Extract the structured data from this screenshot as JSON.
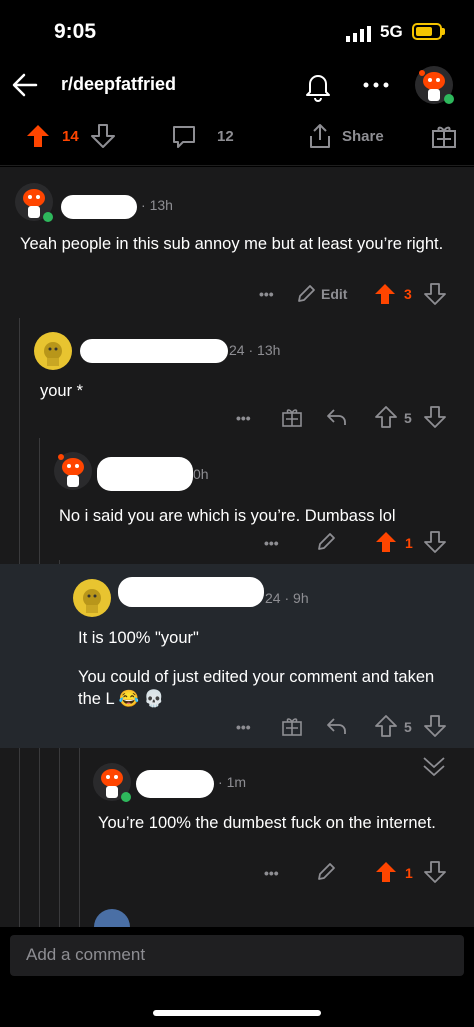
{
  "status": {
    "time": "9:05",
    "network": "5G"
  },
  "header": {
    "subreddit": "r/deepfatfried"
  },
  "post_bar": {
    "votes": "14",
    "comments": "12",
    "share_label": "Share"
  },
  "comments": [
    {
      "time": "13h",
      "text": "Yeah people in this sub annoy me but at least you’re right.",
      "edit_label": "Edit",
      "votes": "3"
    },
    {
      "name_tail": "24",
      "time": "13h",
      "text": "your *",
      "votes": "5"
    },
    {
      "name_tail": "0h",
      "text": "No i said you are which is you’re. Dumbass lol",
      "votes": "1"
    },
    {
      "name_tail": "24",
      "time": "9h",
      "text1": "It is 100% \"your\"",
      "text2": "You could of just edited your comment and taken the L 😂 💀",
      "votes": "5"
    },
    {
      "time": "1m",
      "text": "You’re 100% the dumbest fuck on the internet.",
      "votes": "1"
    }
  ],
  "composer": {
    "placeholder": "Add a comment"
  },
  "colors": {
    "upvote": "#ff4500",
    "background": "#1a1a1b",
    "highlight": "#24282d"
  }
}
